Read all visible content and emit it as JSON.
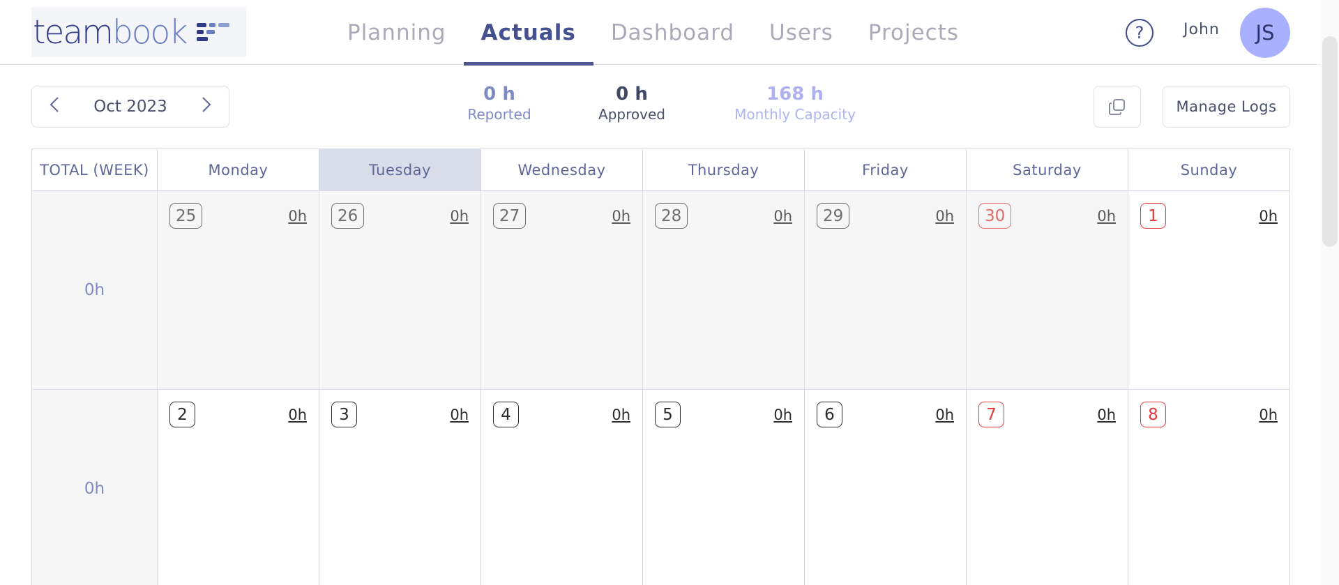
{
  "header": {
    "logo": {
      "part1": "team",
      "part2": "book"
    },
    "nav": [
      {
        "label": "Planning",
        "active": false
      },
      {
        "label": "Actuals",
        "active": true
      },
      {
        "label": "Dashboard",
        "active": false
      },
      {
        "label": "Users",
        "active": false
      },
      {
        "label": "Projects",
        "active": false
      }
    ],
    "help_icon": "?",
    "user": {
      "name": "John",
      "initials": "JS"
    }
  },
  "toolbar": {
    "month": "Oct 2023",
    "stats": {
      "reported": {
        "value": "0 h",
        "label": "Reported"
      },
      "approved": {
        "value": "0 h",
        "label": "Approved"
      },
      "capacity": {
        "value": "168 h",
        "label": "Monthly Capacity"
      }
    },
    "manage_logs": "Manage Logs"
  },
  "calendar": {
    "headers": [
      "TOTAL (WEEK)",
      "Monday",
      "Tuesday",
      "Wednesday",
      "Thursday",
      "Friday",
      "Saturday",
      "Sunday"
    ],
    "today_column": "Tuesday",
    "weeks": [
      {
        "total": "0h",
        "days": [
          {
            "date": "25",
            "hours": "0h"
          },
          {
            "date": "26",
            "hours": "0h"
          },
          {
            "date": "27",
            "hours": "0h"
          },
          {
            "date": "28",
            "hours": "0h"
          },
          {
            "date": "29",
            "hours": "0h"
          },
          {
            "date": "30",
            "hours": "0h"
          },
          {
            "date": "1",
            "hours": "0h"
          }
        ]
      },
      {
        "total": "0h",
        "days": [
          {
            "date": "2",
            "hours": "0h"
          },
          {
            "date": "3",
            "hours": "0h"
          },
          {
            "date": "4",
            "hours": "0h"
          },
          {
            "date": "5",
            "hours": "0h"
          },
          {
            "date": "6",
            "hours": "0h"
          },
          {
            "date": "7",
            "hours": "0h"
          },
          {
            "date": "8",
            "hours": "0h"
          }
        ]
      }
    ]
  },
  "colors": {
    "accent": "#45508f",
    "avatar": "#a9b1ff",
    "weekend": "#e23a3a",
    "today_header": "#d9dde9"
  },
  "icons": [
    "chevron-left-icon",
    "chevron-right-icon",
    "help-icon",
    "copy-icon",
    "logo-mark-icon"
  ]
}
